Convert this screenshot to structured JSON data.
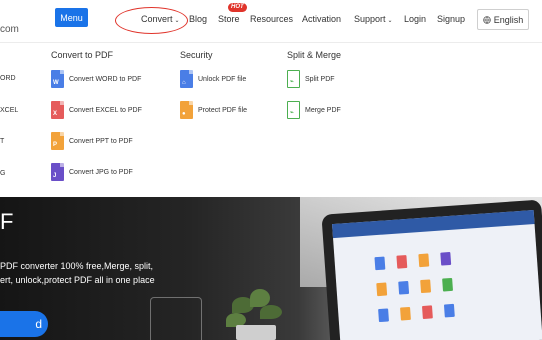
{
  "header": {
    "logo_tail": "com",
    "menu_label": "Menu",
    "nav": {
      "convert": "Convert",
      "blog": "Blog",
      "store": "Store",
      "store_badge": "HOT",
      "resources": "Resources",
      "activation": "Activation",
      "support": "Support",
      "login": "Login",
      "signup": "Signup"
    },
    "language": "English"
  },
  "dropdown": {
    "left_fragments": [
      "ORD",
      "XCEL",
      "T",
      "G"
    ],
    "convert_title": "Convert to PDF",
    "convert_items": [
      {
        "label": "Convert WORD to PDF",
        "icon": "word-file-icon",
        "color": "#4a7ee6"
      },
      {
        "label": "Convert EXCEL to PDF",
        "icon": "excel-file-icon",
        "color": "#e55b5b"
      },
      {
        "label": "Convert PPT to PDF",
        "icon": "ppt-file-icon",
        "color": "#f2a23a"
      },
      {
        "label": "Convert JPG to PDF",
        "icon": "jpg-file-icon",
        "color": "#6a4fc8"
      }
    ],
    "security_title": "Security",
    "security_items": [
      {
        "label": "Unlock PDF file",
        "icon": "unlock-file-icon",
        "color": "#4a7ee6"
      },
      {
        "label": "Protect PDF file",
        "icon": "protect-file-icon",
        "color": "#f2a23a"
      }
    ],
    "split_title": "Split & Merge",
    "split_items": [
      {
        "label": "Split PDF",
        "icon": "split-file-icon",
        "color": "#4caf50"
      },
      {
        "label": "Merge PDF",
        "icon": "merge-file-icon",
        "color": "#4caf50"
      }
    ]
  },
  "hero": {
    "title": "F",
    "line1": "PDF converter 100% free,Merge, split,",
    "line2": "ert, unlock,protect PDF all in one place",
    "button": "d"
  },
  "colors": {
    "accent": "#1a73e8",
    "hot": "#e0342b"
  }
}
